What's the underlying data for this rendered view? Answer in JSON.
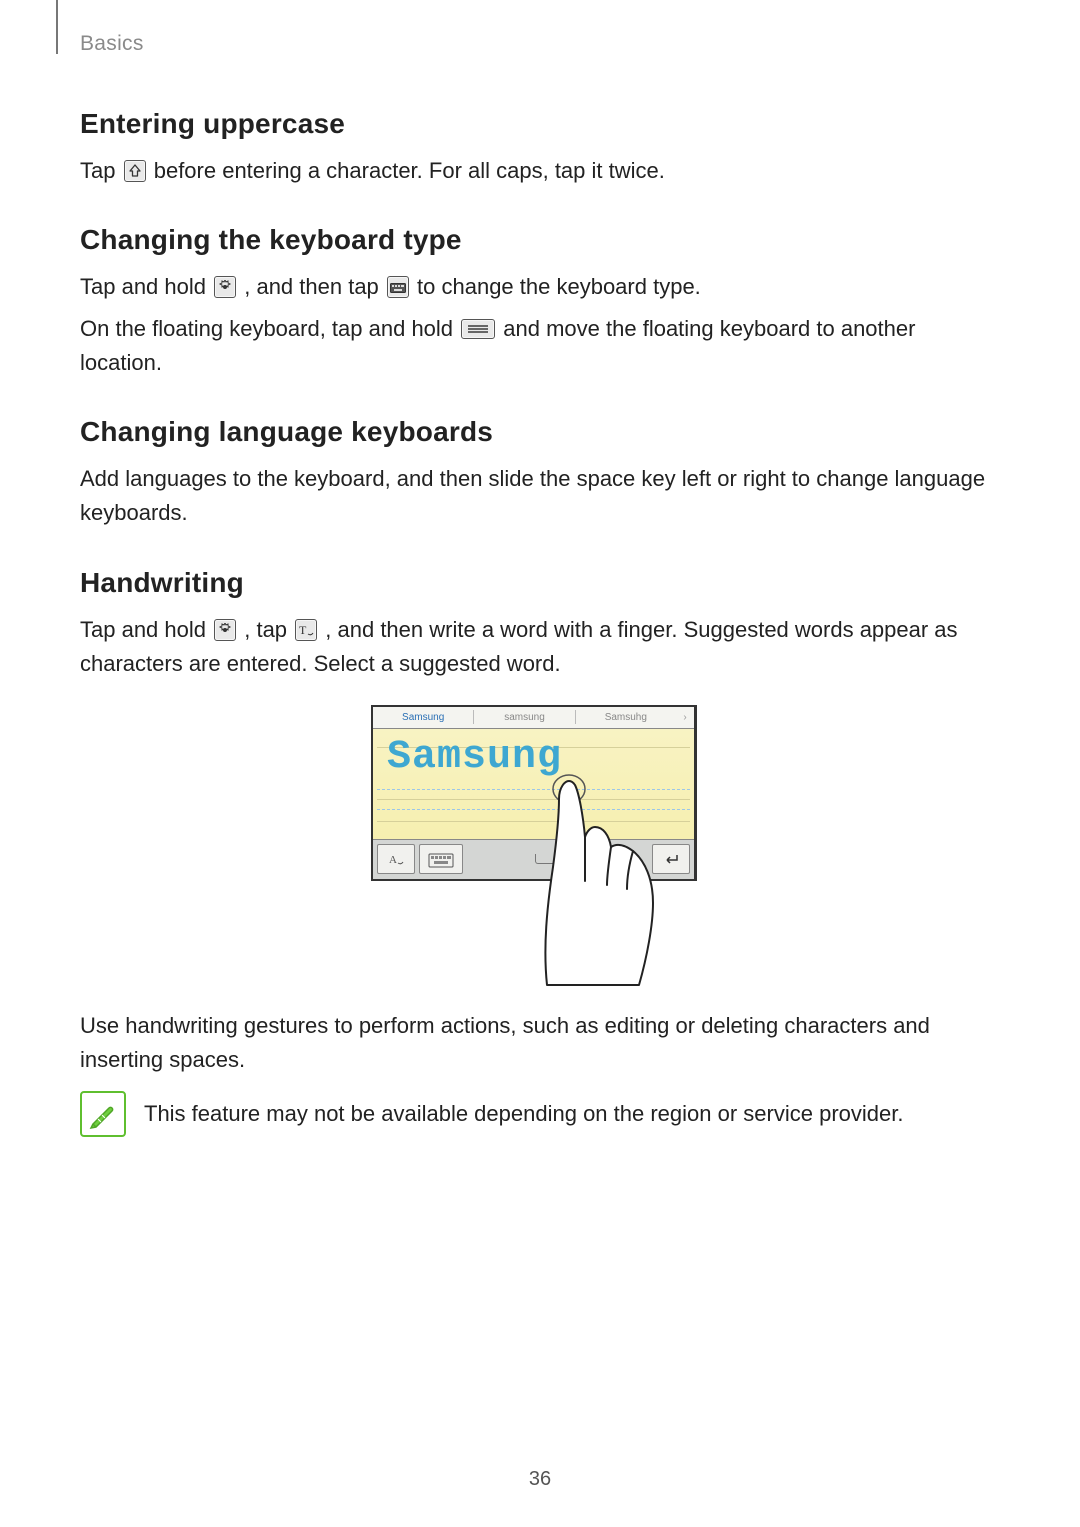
{
  "header": {
    "section_label": "Basics"
  },
  "page_number": "36",
  "sections": {
    "uppercase": {
      "title": "Entering uppercase",
      "line_a": "Tap ",
      "line_b": " before entering a character. For all caps, tap it twice."
    },
    "kbtype": {
      "title": "Changing the keyboard type",
      "p1_a": "Tap and hold ",
      "p1_b": ", and then tap ",
      "p1_c": " to change the keyboard type.",
      "p2_a": "On the floating keyboard, tap and hold ",
      "p2_b": " and move the floating keyboard to another location."
    },
    "lang": {
      "title": "Changing language keyboards",
      "p1": "Add languages to the keyboard, and then slide the space key left or right to change language keyboards."
    },
    "handwriting": {
      "title": "Handwriting",
      "p1_a": "Tap and hold ",
      "p1_b": ", tap ",
      "p1_c": ", and then write a word with a finger. Suggested words appear as characters are entered. Select a suggested word.",
      "p2": "Use handwriting gestures to perform actions, such as editing or deleting characters and inserting spaces.",
      "note": "This feature may not be available depending on the region or service provider."
    }
  },
  "illustration": {
    "suggestions": {
      "selected": "Samsung",
      "alt1": "samsung",
      "alt2": "Samsuhg",
      "arrow": "›"
    },
    "handwritten_word": "Samsung"
  },
  "icons": {
    "shift": "shift-icon",
    "gear": "gear-icon",
    "keyboard": "keyboard-icon",
    "grip": "grip-icon",
    "text_t": "text-t-icon",
    "note": "note-pen-icon"
  }
}
